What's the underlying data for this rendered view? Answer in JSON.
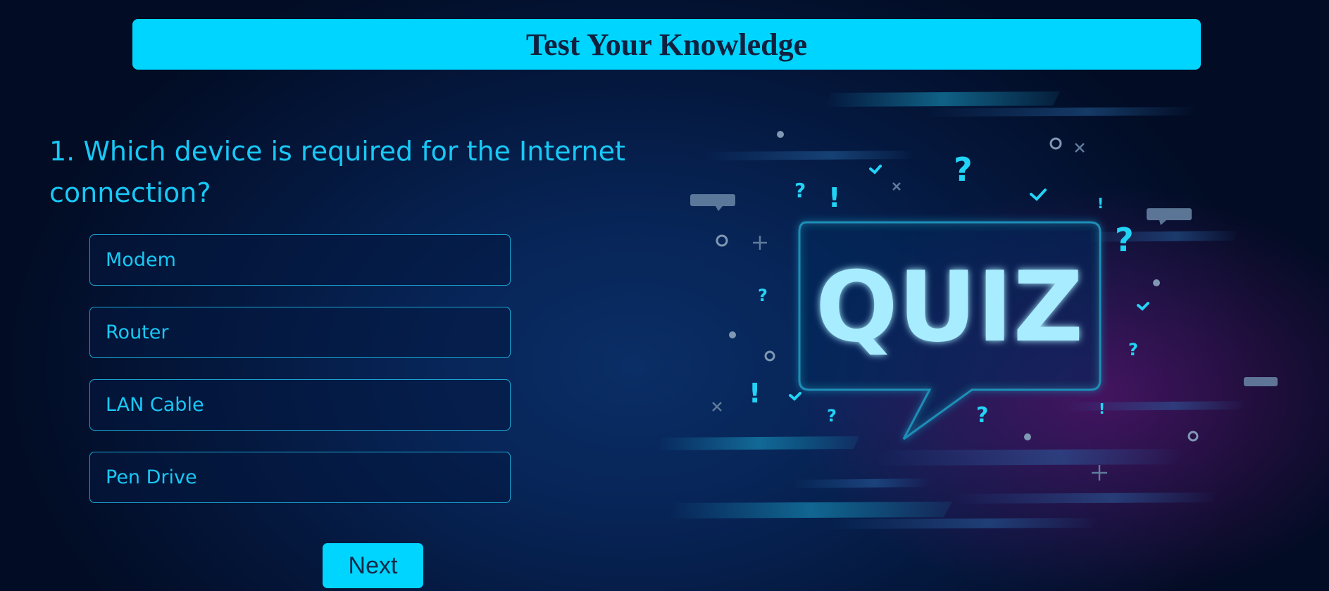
{
  "header": {
    "title": "Test Your Knowledge"
  },
  "question": {
    "text": "1. Which device is required for the Internet connection?"
  },
  "options": [
    {
      "label": "Modem"
    },
    {
      "label": "Router"
    },
    {
      "label": "LAN Cable"
    },
    {
      "label": "Pen Drive"
    }
  ],
  "next_button": {
    "label": "Next"
  },
  "illustration": {
    "text": "QUIZ",
    "icon": "quiz-speech-bubble-illustration"
  },
  "colors": {
    "accent": "#00d5ff",
    "text_accent": "#18c8f5",
    "background": "#04163a"
  }
}
